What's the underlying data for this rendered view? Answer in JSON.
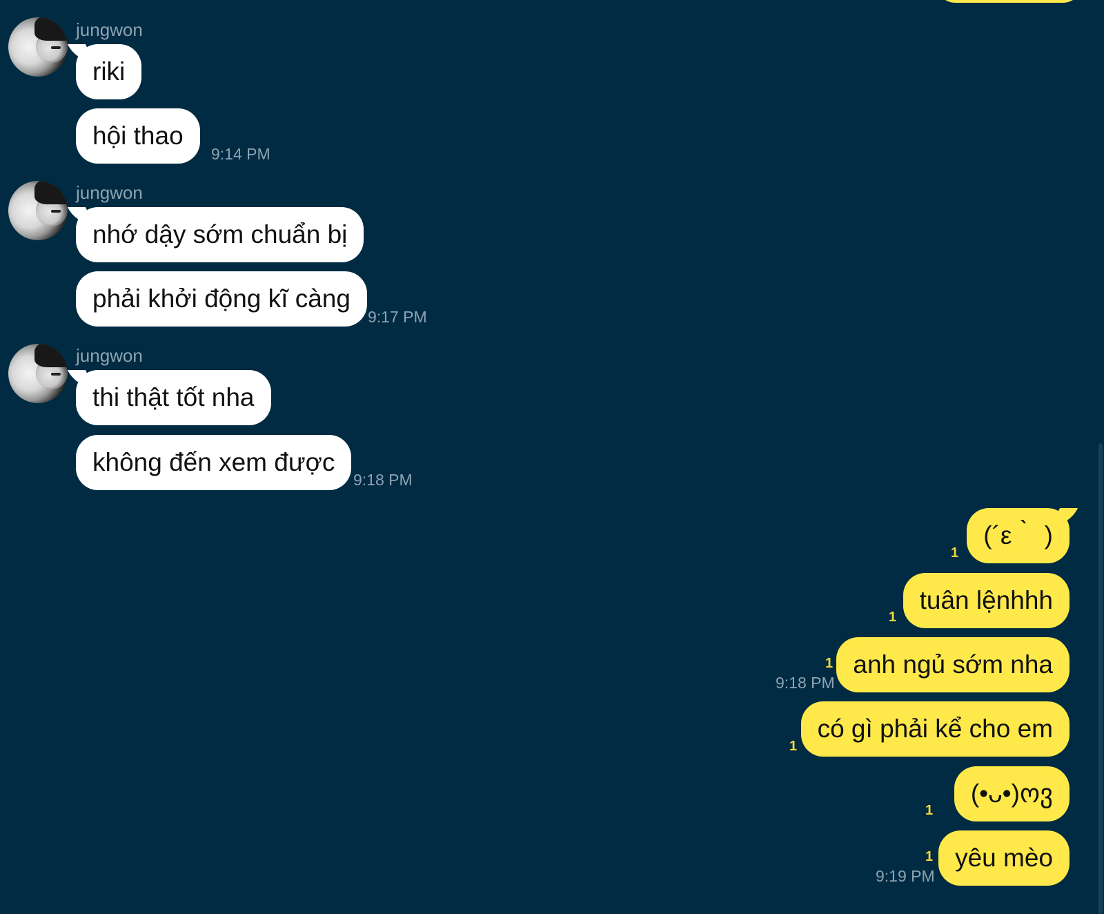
{
  "colors": {
    "background": "#002b42",
    "incoming_bubble": "#ffffff",
    "outgoing_bubble": "#fee84a",
    "meta_text": "#8da3b2",
    "unread_count": "#f5d83c"
  },
  "incoming_groups": [
    {
      "sender": "jungwon",
      "avatar_icon": "profile-photo",
      "messages": [
        "riki",
        "hội thao"
      ],
      "time": "9:14 PM"
    },
    {
      "sender": "jungwon",
      "avatar_icon": "profile-photo",
      "messages": [
        "nhớ dậy sớm chuẩn bị",
        "phải khởi động kĩ càng"
      ],
      "time": "9:17 PM"
    },
    {
      "sender": "jungwon",
      "avatar_icon": "profile-photo",
      "messages": [
        "thi thật tốt nha",
        "không đến xem được"
      ],
      "time": "9:18 PM"
    }
  ],
  "outgoing_messages": [
    {
      "text": "(´ε｀ )",
      "unread": "1"
    },
    {
      "text": "tuân lệnhhh",
      "unread": "1"
    },
    {
      "text": "anh ngủ sớm nha",
      "unread": "1",
      "time": "9:18 PM"
    },
    {
      "text": "có gì phải kể cho em",
      "unread": "1"
    },
    {
      "text": "(•ᴗ•)ოვ",
      "unread": "1"
    },
    {
      "text": "yêu mèo",
      "unread": "1",
      "time": "9:19 PM"
    }
  ]
}
